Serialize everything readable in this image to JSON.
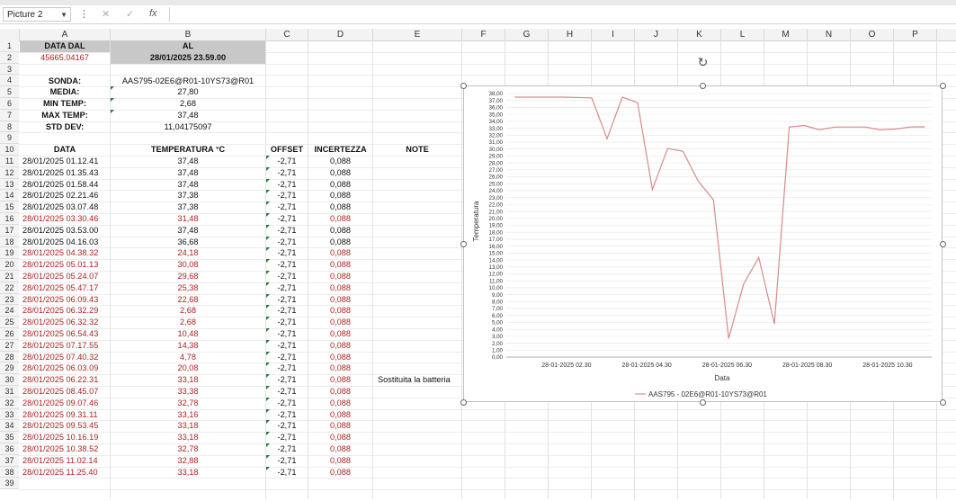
{
  "name_box": {
    "value": "Picture 2"
  },
  "formula_bar": {
    "cancel": "✕",
    "enter": "✓",
    "fx": "fx",
    "value": ""
  },
  "columns": [
    "A",
    "B",
    "C",
    "D",
    "E",
    "F",
    "G",
    "H",
    "I",
    "J",
    "K",
    "L",
    "M",
    "N",
    "O",
    "P"
  ],
  "row_numbers": [
    "1",
    "2",
    "3",
    "4",
    "5",
    "6",
    "7",
    "8",
    "9",
    "10",
    "11",
    "12",
    "13",
    "14",
    "15",
    "16",
    "17",
    "18",
    "19",
    "20",
    "21",
    "22",
    "23",
    "24",
    "25",
    "26",
    "27",
    "28",
    "29",
    "30",
    "31",
    "32",
    "33",
    "34",
    "35",
    "36",
    "37",
    "38",
    "39"
  ],
  "header_block": {
    "data_dal_label": "DATA DAL",
    "al_label": "AL",
    "data_dal_value": "45665.04167",
    "al_value": "28/01/2025 23.59.00"
  },
  "stats": {
    "sonda_label": "SONDA:",
    "sonda_value": "AAS795-02E6@R01-10YS73@R01",
    "media_label": "MEDIA:",
    "media_value": "27,80",
    "min_label": "MIN TEMP:",
    "min_value": "2,68",
    "max_label": "MAX TEMP:",
    "max_value": "37,48",
    "std_label": "STD DEV:",
    "std_value": "11,04175097"
  },
  "table_headers": {
    "data": "DATA",
    "temperatura": "TEMPERATURA °C",
    "offset": "OFFSET",
    "incertezza": "INCERTEZZA",
    "note": "NOTE"
  },
  "table_rows": [
    {
      "data": "28/01/2025 01.12.41",
      "temp": "37,48",
      "offset": "-2,71",
      "inc": "0,088",
      "note": "",
      "red": false
    },
    {
      "data": "28/01/2025 01.35.43",
      "temp": "37,48",
      "offset": "-2,71",
      "inc": "0,088",
      "note": "",
      "red": false
    },
    {
      "data": "28/01/2025 01.58.44",
      "temp": "37,48",
      "offset": "-2,71",
      "inc": "0,088",
      "note": "",
      "red": false
    },
    {
      "data": "28/01/2025 02.21.46",
      "temp": "37,38",
      "offset": "-2,71",
      "inc": "0,088",
      "note": "",
      "red": false
    },
    {
      "data": "28/01/2025 03.07.48",
      "temp": "37,38",
      "offset": "-2,71",
      "inc": "0,088",
      "note": "",
      "red": false
    },
    {
      "data": "28/01/2025 03.30.46",
      "temp": "31,48",
      "offset": "-2,71",
      "inc": "0,088",
      "note": "",
      "red": true
    },
    {
      "data": "28/01/2025 03.53.00",
      "temp": "37,48",
      "offset": "-2,71",
      "inc": "0,088",
      "note": "",
      "red": false
    },
    {
      "data": "28/01/2025 04.16.03",
      "temp": "36,68",
      "offset": "-2,71",
      "inc": "0,088",
      "note": "",
      "red": false
    },
    {
      "data": "28/01/2025 04.38.32",
      "temp": "24,18",
      "offset": "-2,71",
      "inc": "0,088",
      "note": "",
      "red": true
    },
    {
      "data": "28/01/2025 05.01.13",
      "temp": "30,08",
      "offset": "-2,71",
      "inc": "0,088",
      "note": "",
      "red": true
    },
    {
      "data": "28/01/2025 05.24.07",
      "temp": "29,68",
      "offset": "-2,71",
      "inc": "0,088",
      "note": "",
      "red": true
    },
    {
      "data": "28/01/2025 05.47.17",
      "temp": "25,38",
      "offset": "-2,71",
      "inc": "0,088",
      "note": "",
      "red": true
    },
    {
      "data": "28/01/2025 06.09.43",
      "temp": "22,68",
      "offset": "-2,71",
      "inc": "0,088",
      "note": "",
      "red": true
    },
    {
      "data": "28/01/2025 06.32.29",
      "temp": "2,68",
      "offset": "-2,71",
      "inc": "0,088",
      "note": "",
      "red": true
    },
    {
      "data": "28/01/2025 06.32.32",
      "temp": "2,68",
      "offset": "-2,71",
      "inc": "0,088",
      "note": "",
      "red": true
    },
    {
      "data": "28/01/2025 06.54.43",
      "temp": "10,48",
      "offset": "-2,71",
      "inc": "0,088",
      "note": "",
      "red": true
    },
    {
      "data": "28/01/2025 07.17.55",
      "temp": "14,38",
      "offset": "-2,71",
      "inc": "0,088",
      "note": "",
      "red": true
    },
    {
      "data": "28/01/2025 07.40.32",
      "temp": "4,78",
      "offset": "-2,71",
      "inc": "0,088",
      "note": "",
      "red": true
    },
    {
      "data": "28/01/2025 06.03.09",
      "temp": "20,08",
      "offset": "-2,71",
      "inc": "0,088",
      "note": "",
      "red": true
    },
    {
      "data": "28/01/2025 06.22.31",
      "temp": "33,18",
      "offset": "-2,71",
      "inc": "0,088",
      "note": "Sostituita la batteria",
      "red": true
    },
    {
      "data": "28/01/2025 08.45.07",
      "temp": "33,38",
      "offset": "-2,71",
      "inc": "0,088",
      "note": "",
      "red": true
    },
    {
      "data": "28/01/2025 09.07.46",
      "temp": "32,78",
      "offset": "-2,71",
      "inc": "0,088",
      "note": "",
      "red": true
    },
    {
      "data": "28/01/2025 09.31.11",
      "temp": "33,16",
      "offset": "-2,71",
      "inc": "0,088",
      "note": "",
      "red": true
    },
    {
      "data": "28/01/2025 09.53.45",
      "temp": "33,18",
      "offset": "-2,71",
      "inc": "0,088",
      "note": "",
      "red": true
    },
    {
      "data": "28/01/2025 10.16.19",
      "temp": "33,18",
      "offset": "-2,71",
      "inc": "0,088",
      "note": "",
      "red": true
    },
    {
      "data": "28/01/2025 10.38.52",
      "temp": "32,78",
      "offset": "-2,71",
      "inc": "0,088",
      "note": "",
      "red": true
    },
    {
      "data": "28/01/2025 11.02.14",
      "temp": "32,88",
      "offset": "-2,71",
      "inc": "0,088",
      "note": "",
      "red": true
    },
    {
      "data": "28/01/2025 11.25.40",
      "temp": "33,18",
      "offset": "-2,71",
      "inc": "0,088",
      "note": "",
      "red": true
    }
  ],
  "colors": {
    "red_text": "#b02020",
    "header_gray": "#c8c8c8",
    "series_line": "#d98a8a",
    "green_marker": "#1e7a3a"
  },
  "chart_data": {
    "type": "line",
    "xlabel": "Data",
    "ylabel": "Temperatura",
    "ylim": [
      0,
      36
    ],
    "y_ticks": [
      "0,00",
      "1,00",
      "2,00",
      "3,00",
      "4,00",
      "5,00",
      "6,00",
      "7,00",
      "8,00",
      "9,00",
      "10,00",
      "11,00",
      "12,00",
      "13,00",
      "14,00",
      "15,00",
      "16,00",
      "17,00",
      "18,00",
      "19,00",
      "20,00",
      "21,00",
      "22,00",
      "23,00",
      "24,00",
      "25,00",
      "26,00",
      "27,00",
      "28,00",
      "29,00",
      "30,00",
      "31,00",
      "32,00",
      "33,00",
      "34,00",
      "35,00",
      "36,00",
      "37,00",
      "38,00"
    ],
    "x_ticks": [
      {
        "label": "28-01-2025 02.30",
        "t": 2.5
      },
      {
        "label": "28-01-2025 04.30",
        "t": 4.5
      },
      {
        "label": "28-01-2025 06.30",
        "t": 6.5
      },
      {
        "label": "28-01-2025 08.30",
        "t": 8.5
      },
      {
        "label": "28-01-2025 10.30",
        "t": 10.5
      }
    ],
    "x_range_hours": [
      1.0,
      11.6
    ],
    "grid": true,
    "legend_position": "bottom",
    "series": [
      {
        "name": "AAS795 - 02E6@R01-10YS73@R01",
        "x": [
          1.21,
          2.36,
          3.13,
          3.51,
          3.89,
          4.27,
          4.64,
          5.02,
          5.4,
          5.78,
          6.16,
          6.54,
          6.91,
          7.29,
          7.68,
          8.05,
          8.43,
          8.8,
          9.18,
          9.56,
          9.94,
          10.31,
          10.69,
          11.07,
          11.43
        ],
        "y": [
          37.48,
          37.48,
          37.38,
          31.48,
          37.48,
          36.68,
          24.18,
          30.08,
          29.68,
          25.38,
          22.68,
          2.68,
          10.48,
          14.38,
          4.78,
          33.18,
          33.38,
          32.78,
          33.16,
          33.18,
          33.18,
          32.78,
          32.88,
          33.18,
          33.2
        ]
      }
    ]
  }
}
